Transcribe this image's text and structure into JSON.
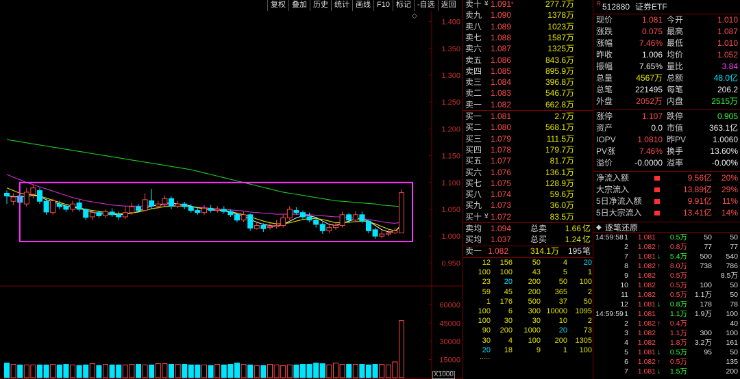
{
  "toolbar": [
    "复权",
    "叠加",
    "历史",
    "统计",
    "画线",
    "F10",
    "标记",
    "-自选",
    "返回"
  ],
  "chart_data": {
    "type": "candlestick",
    "price_ticks": [
      "1.400",
      "1.350",
      "1.300",
      "1.250",
      "1.200",
      "1.150",
      "1.100",
      "1.050",
      "1.000",
      "0.950"
    ],
    "price_range": [
      0.925,
      1.425
    ],
    "volume_ticks": [
      "60000",
      "45000",
      "30000",
      "15000"
    ],
    "volume_range": [
      0,
      70000
    ],
    "volume_unit": "X1000",
    "candles": [
      [
        1.08,
        1.075,
        1.085,
        1.06
      ],
      [
        1.065,
        1.073,
        1.08,
        1.058
      ],
      [
        1.075,
        1.063,
        1.082,
        1.058
      ],
      [
        1.06,
        1.082,
        1.09,
        1.055
      ],
      [
        1.078,
        1.09,
        1.096,
        1.07
      ],
      [
        1.085,
        1.065,
        1.09,
        1.06
      ],
      [
        1.065,
        1.045,
        1.07,
        1.04
      ],
      [
        1.044,
        1.066,
        1.07,
        1.04
      ],
      [
        1.06,
        1.055,
        1.066,
        1.05
      ],
      [
        1.056,
        1.05,
        1.06,
        1.045
      ],
      [
        1.05,
        1.06,
        1.066,
        1.045
      ],
      [
        1.062,
        1.05,
        1.068,
        1.046
      ],
      [
        1.05,
        1.035,
        1.052,
        1.03
      ],
      [
        1.036,
        1.044,
        1.048,
        1.03
      ],
      [
        1.044,
        1.038,
        1.048,
        1.034
      ],
      [
        1.038,
        1.046,
        1.05,
        1.034
      ],
      [
        1.045,
        1.04,
        1.052,
        1.036
      ],
      [
        1.04,
        1.036,
        1.046,
        1.03
      ],
      [
        1.036,
        1.044,
        1.056,
        1.032
      ],
      [
        1.044,
        1.055,
        1.062,
        1.04
      ],
      [
        1.055,
        1.048,
        1.06,
        1.044
      ],
      [
        1.048,
        1.068,
        1.08,
        1.046
      ],
      [
        1.066,
        1.056,
        1.088,
        1.05
      ],
      [
        1.056,
        1.06,
        1.066,
        1.05
      ],
      [
        1.06,
        1.07,
        1.076,
        1.056
      ],
      [
        1.07,
        1.056,
        1.074,
        1.05
      ],
      [
        1.056,
        1.06,
        1.066,
        1.052
      ],
      [
        1.06,
        1.055,
        1.064,
        1.05
      ],
      [
        1.055,
        1.048,
        1.06,
        1.044
      ],
      [
        1.048,
        1.044,
        1.054,
        1.04
      ],
      [
        1.044,
        1.052,
        1.058,
        1.04
      ],
      [
        1.052,
        1.048,
        1.058,
        1.044
      ],
      [
        1.048,
        1.05,
        1.056,
        1.044
      ],
      [
        1.05,
        1.046,
        1.056,
        1.042
      ],
      [
        1.046,
        1.04,
        1.05,
        1.036
      ],
      [
        1.04,
        1.03,
        1.044,
        1.026
      ],
      [
        1.03,
        1.04,
        1.046,
        1.026
      ],
      [
        1.04,
        1.015,
        1.042,
        1.01
      ],
      [
        1.014,
        1.02,
        1.026,
        1.012
      ],
      [
        1.02,
        1.014,
        1.024,
        1.008
      ],
      [
        1.016,
        1.018,
        1.024,
        1.012
      ],
      [
        1.018,
        1.02,
        1.03,
        1.014
      ],
      [
        1.02,
        1.034,
        1.04,
        1.016
      ],
      [
        1.034,
        1.05,
        1.056,
        1.03
      ],
      [
        1.048,
        1.044,
        1.054,
        1.04
      ],
      [
        1.044,
        1.036,
        1.048,
        1.03
      ],
      [
        1.036,
        1.03,
        1.044,
        1.026
      ],
      [
        1.03,
        1.022,
        1.036,
        1.016
      ],
      [
        1.022,
        1.01,
        1.026,
        1.004
      ],
      [
        1.01,
        1.016,
        1.024,
        1.006
      ],
      [
        1.016,
        1.02,
        1.026,
        1.012
      ],
      [
        1.02,
        1.04,
        1.046,
        1.016
      ],
      [
        1.04,
        1.03,
        1.044,
        1.024
      ],
      [
        1.03,
        1.04,
        1.046,
        1.026
      ],
      [
        1.04,
        1.028,
        1.046,
        1.024
      ],
      [
        1.028,
        1.01,
        1.03,
        1.005
      ],
      [
        1.012,
        1.0,
        1.016,
        0.995
      ],
      [
        1.0,
        1.004,
        1.01,
        0.996
      ],
      [
        1.004,
        1.006,
        1.014,
        1.0
      ],
      [
        1.006,
        1.01,
        1.016,
        1.004
      ],
      [
        1.006,
        1.081,
        1.087,
        1.006
      ]
    ],
    "volumes": [
      12000,
      11000,
      10500,
      10500,
      10500,
      10500,
      10500,
      11000,
      10500,
      11000,
      10500,
      10000,
      10500,
      11500,
      10000,
      11000,
      10500,
      10500,
      10500,
      11000,
      11000,
      10500,
      10500,
      11500,
      11500,
      11000,
      11000,
      11000,
      10500,
      10500,
      10500,
      10000,
      11000,
      10500,
      11000,
      12000,
      11000,
      10500,
      10000,
      10000,
      11000,
      10500,
      10000,
      10500,
      10500,
      11000,
      11000,
      12000,
      11500,
      10500,
      12000,
      11000,
      11000,
      11000,
      11000,
      10500,
      11000,
      11000,
      10500,
      13000,
      47000
    ],
    "ma_green": [
      1.18,
      1.178,
      1.176,
      1.174,
      1.172,
      1.17,
      1.168,
      1.166,
      1.164,
      1.162,
      1.16,
      1.158,
      1.156,
      1.154,
      1.152,
      1.15,
      1.148,
      1.146,
      1.144,
      1.142,
      1.14,
      1.138,
      1.136,
      1.134,
      1.132,
      1.13,
      1.128,
      1.126,
      1.124,
      1.121,
      1.118,
      1.115,
      1.112,
      1.109,
      1.106,
      1.103,
      1.1,
      1.097,
      1.094,
      1.091,
      1.088,
      1.085,
      1.082,
      1.08,
      1.078,
      1.076,
      1.074,
      1.072,
      1.07,
      1.068,
      1.066,
      1.065,
      1.064,
      1.063,
      1.062,
      1.061,
      1.06,
      1.058,
      1.057,
      1.056,
      1.055
    ],
    "ma_magenta": [
      1.115,
      1.11,
      1.105,
      1.1,
      1.096,
      1.092,
      1.088,
      1.084,
      1.08,
      1.076,
      1.072,
      1.069,
      1.066,
      1.064,
      1.062,
      1.06,
      1.058,
      1.057,
      1.056,
      1.056,
      1.056,
      1.056,
      1.057,
      1.058,
      1.058,
      1.058,
      1.057,
      1.056,
      1.055,
      1.054,
      1.053,
      1.052,
      1.051,
      1.05,
      1.049,
      1.048,
      1.047,
      1.045,
      1.044,
      1.043,
      1.042,
      1.041,
      1.041,
      1.041,
      1.041,
      1.041,
      1.04,
      1.039,
      1.038,
      1.037,
      1.036,
      1.036,
      1.035,
      1.034,
      1.033,
      1.031,
      1.029,
      1.027,
      1.025,
      1.024,
      1.026
    ],
    "ma_white": [
      1.075,
      1.074,
      1.073,
      1.074,
      1.076,
      1.074,
      1.068,
      1.064,
      1.06,
      1.056,
      1.054,
      1.052,
      1.048,
      1.045,
      1.042,
      1.041,
      1.041,
      1.04,
      1.041,
      1.043,
      1.046,
      1.052,
      1.056,
      1.058,
      1.061,
      1.062,
      1.06,
      1.059,
      1.056,
      1.053,
      1.051,
      1.049,
      1.048,
      1.047,
      1.045,
      1.041,
      1.038,
      1.031,
      1.026,
      1.022,
      1.02,
      1.018,
      1.022,
      1.028,
      1.034,
      1.038,
      1.038,
      1.035,
      1.028,
      1.022,
      1.02,
      1.024,
      1.028,
      1.032,
      1.032,
      1.028,
      1.02,
      1.012,
      1.008,
      1.008,
      1.022
    ],
    "ma_yellow": [
      1.09,
      1.085,
      1.08,
      1.078,
      1.077,
      1.075,
      1.071,
      1.067,
      1.063,
      1.059,
      1.056,
      1.053,
      1.05,
      1.048,
      1.046,
      1.044,
      1.043,
      1.042,
      1.042,
      1.043,
      1.045,
      1.048,
      1.051,
      1.053,
      1.055,
      1.056,
      1.056,
      1.056,
      1.055,
      1.053,
      1.051,
      1.05,
      1.049,
      1.048,
      1.046,
      1.043,
      1.04,
      1.036,
      1.032,
      1.028,
      1.025,
      1.023,
      1.023,
      1.025,
      1.028,
      1.031,
      1.033,
      1.033,
      1.031,
      1.028,
      1.025,
      1.025,
      1.026,
      1.027,
      1.028,
      1.027,
      1.023,
      1.018,
      1.013,
      1.01,
      1.018
    ],
    "highlight_box": {
      "from_index": 3,
      "to_index": 60,
      "price_top": 1.1,
      "price_bottom": 0.99
    }
  },
  "sell_orders": [
    {
      "label": "卖十",
      "price": "1.091",
      "vol": "277.7",
      "unit": "万",
      "mark": "¥",
      "mark2": "*"
    },
    {
      "label": "卖九",
      "price": "1.090",
      "vol": "1378",
      "unit": "万"
    },
    {
      "label": "卖八",
      "price": "1.089",
      "vol": "1023",
      "unit": "万"
    },
    {
      "label": "卖七",
      "price": "1.088",
      "vol": "1587",
      "unit": "万"
    },
    {
      "label": "卖六",
      "price": "1.087",
      "vol": "1325",
      "unit": "万"
    },
    {
      "label": "卖五",
      "price": "1.086",
      "vol": "843.6",
      "unit": "万"
    },
    {
      "label": "卖四",
      "price": "1.085",
      "vol": "895.9",
      "unit": "万"
    },
    {
      "label": "卖三",
      "price": "1.084",
      "vol": "396.8",
      "unit": "万"
    },
    {
      "label": "卖二",
      "price": "1.083",
      "vol": "546.7",
      "unit": "万"
    },
    {
      "label": "卖一",
      "price": "1.082",
      "vol": "662.8",
      "unit": "万"
    }
  ],
  "buy_orders": [
    {
      "label": "买一",
      "price": "1.081",
      "vol": "2.7",
      "unit": "万"
    },
    {
      "label": "买二",
      "price": "1.080",
      "vol": "568.1",
      "unit": "万"
    },
    {
      "label": "买三",
      "price": "1.079",
      "vol": "111.5",
      "unit": "万"
    },
    {
      "label": "买四",
      "price": "1.078",
      "vol": "179.7",
      "unit": "万"
    },
    {
      "label": "买五",
      "price": "1.077",
      "vol": "81.7",
      "unit": "万"
    },
    {
      "label": "买六",
      "price": "1.076",
      "vol": "136.1",
      "unit": "万"
    },
    {
      "label": "买七",
      "price": "1.075",
      "vol": "128.9",
      "unit": "万"
    },
    {
      "label": "买八",
      "price": "1.074",
      "vol": "59.6",
      "unit": "万"
    },
    {
      "label": "买九",
      "price": "1.073",
      "vol": "36.0",
      "unit": "万"
    },
    {
      "label": "买十",
      "price": "1.072",
      "vol": "83.5",
      "unit": "万",
      "mark": "¥"
    }
  ],
  "avg": {
    "sell_avg_label": "卖均",
    "sell_avg": "1.094",
    "sell_total_label": "总卖",
    "sell_total": "1.66",
    "sell_total_unit": "亿",
    "buy_avg_label": "买均",
    "buy_avg": "1.037",
    "buy_total_label": "总买",
    "buy_total": "1.24",
    "buy_total_unit": "亿"
  },
  "queue": {
    "label": "卖一",
    "price": "1.082",
    "vol": "314.1",
    "unit": "万",
    "count": "195",
    "count_unit": "笔",
    "rows": [
      [
        "12",
        "156",
        "50",
        "4",
        "20"
      ],
      [
        "100",
        "100",
        "43",
        "5",
        "1"
      ],
      [
        "23",
        "20",
        "200",
        "50",
        "100"
      ],
      [
        "59",
        "45",
        "200",
        "365",
        "2"
      ],
      [
        "1",
        "176",
        "500",
        "37",
        "50"
      ],
      [
        "100",
        "6",
        "300",
        "10000",
        "1095"
      ],
      [
        "100",
        "30",
        "30",
        "10",
        "2"
      ],
      [
        "90",
        "200",
        "1000",
        "20",
        "73"
      ],
      [
        "30",
        "4",
        "100",
        "200",
        "1305"
      ],
      [
        "20",
        "18",
        "9",
        "1",
        "100"
      ]
    ],
    "more": "....."
  },
  "stock": {
    "code": "512880",
    "name": "证券ETF",
    "prefix": "R"
  },
  "quote_rows": [
    {
      "l1": "现价",
      "v1": "1.081",
      "c1": "red",
      "l2": "今开",
      "v2": "1.010",
      "c2": "red"
    },
    {
      "l1": "涨跌",
      "v1": "0.075",
      "c1": "red",
      "l2": "最高",
      "v2": "1.087",
      "c2": "red"
    },
    {
      "l1": "涨幅",
      "v1": "7.46%",
      "c1": "red",
      "l2": "最低",
      "v2": "1.010",
      "c2": "red"
    },
    {
      "l1": "昨收",
      "v1": "1.006",
      "c1": "white",
      "l2": "均价",
      "v2": "1.052",
      "c2": "red"
    },
    {
      "l1": "振幅",
      "v1": "7.65%",
      "c1": "white",
      "l2": "量比",
      "v2": "3.84",
      "c2": "magenta"
    },
    {
      "l1": "总量",
      "v1": "4567万",
      "c1": "yellow",
      "l2": "总额",
      "v2": "48.0亿",
      "c2": "cyan"
    },
    {
      "l1": "总笔",
      "v1": "221495",
      "c1": "white",
      "l2": "每笔",
      "v2": "206.2",
      "c2": "white"
    },
    {
      "l1": "外盘",
      "v1": "2052万",
      "c1": "red",
      "l2": "内盘",
      "v2": "2515万",
      "c2": "green"
    }
  ],
  "quote_rows2": [
    {
      "l1": "涨停",
      "v1": "1.107",
      "c1": "red",
      "l2": "跌停",
      "v2": "0.905",
      "c2": "green"
    },
    {
      "l1": "资产",
      "v1": "0.0",
      "c1": "white",
      "l2": "市值",
      "v2": "363.1亿",
      "c2": "white"
    },
    {
      "l1": "IOPV",
      "v1": "1.0810",
      "c1": "red",
      "l2": "昨PV",
      "v2": "1.0060",
      "c2": "white"
    },
    {
      "l1": "PV涨",
      "v1": "7.46%",
      "c1": "red",
      "l2": "换手",
      "v2": "13.60%",
      "c2": "white"
    },
    {
      "l1": "溢价",
      "v1": "-0.0000",
      "c1": "white",
      "l2": "溢率",
      "v2": "-0.00%",
      "c2": "white"
    }
  ],
  "flows": [
    {
      "label": "净流入额",
      "value": "9.56亿",
      "pct": "20%"
    },
    {
      "label": "大宗流入",
      "value": "13.89亿",
      "pct": "29%"
    },
    {
      "label": "5日净流入额",
      "value": "9.91亿",
      "pct": "11%"
    },
    {
      "label": "5日大宗流入",
      "value": "13.41亿",
      "pct": "14%"
    }
  ],
  "ticks_title": "逐笔还原",
  "ticks": [
    {
      "t": "14:59:58",
      "a": "1",
      "p": "1.081",
      "d": "",
      "v": "0.5万",
      "vc": "green",
      "x": "50",
      "y": "50",
      "xc": "white"
    },
    {
      "t": "",
      "a": "2",
      "p": "1.082",
      "d": "↑",
      "v": "0.8万",
      "vc": "red",
      "x": "77",
      "y": "77",
      "xc": "white"
    },
    {
      "t": "",
      "a": "7",
      "p": "1.081",
      "d": "↓",
      "v": "5.4万",
      "vc": "green",
      "x": "500",
      "y": "540",
      "xc": "white"
    },
    {
      "t": "",
      "a": "8",
      "p": "1.082",
      "d": "↑",
      "v": "8.0万",
      "vc": "red",
      "x": "738",
      "y": "786",
      "xc": "white"
    },
    {
      "t": "",
      "a": "9",
      "p": "1.082",
      "d": "",
      "v": "0.5万",
      "vc": "red",
      "x": "",
      "y": "8.5万",
      "xc": "white"
    },
    {
      "t": "",
      "a": "10",
      "p": "1.082",
      "d": "",
      "v": "0.5万",
      "vc": "red",
      "x": "100",
      "y": "50",
      "xc": "white"
    },
    {
      "t": "",
      "a": "11",
      "p": "1.082",
      "d": "",
      "v": "0.5万",
      "vc": "red",
      "x": "1.1万",
      "y": "50",
      "xc": "white"
    },
    {
      "t": "",
      "a": "12",
      "p": "1.081",
      "d": "↓",
      "v": "0.8万",
      "vc": "green",
      "x": "178",
      "y": "78",
      "xc": "white"
    },
    {
      "t": "14:59:59",
      "a": "1",
      "p": "1.081",
      "d": "",
      "v": "1.1万",
      "vc": "green",
      "x": "1.9万",
      "y": "100",
      "xc": "white"
    },
    {
      "t": "",
      "a": "2",
      "p": "1.082",
      "d": "↑",
      "v": "0.4万",
      "vc": "red",
      "x": "",
      "y": "40",
      "xc": "white"
    },
    {
      "t": "",
      "a": "3",
      "p": "1.082",
      "d": "",
      "v": "1.1万",
      "vc": "red",
      "x": "300",
      "y": "100",
      "xc": "white"
    },
    {
      "t": "",
      "a": "4",
      "p": "1.082",
      "d": "",
      "v": "1.8万",
      "vc": "red",
      "x": "3.2万",
      "y": "161",
      "xc": "white"
    },
    {
      "t": "",
      "a": "5",
      "p": "1.081",
      "d": "↓",
      "v": "0.5万",
      "vc": "green",
      "x": "95",
      "y": "50",
      "xc": "white"
    },
    {
      "t": "",
      "a": "6",
      "p": "1.082",
      "d": "↑",
      "v": "0.5万",
      "vc": "red",
      "x": "",
      "y": "135",
      "xc": "white"
    },
    {
      "t": "",
      "a": "7",
      "p": "1.081",
      "d": "↓",
      "v": "1.5万",
      "vc": "green",
      "x": "",
      "y": "200",
      "xc": "white"
    }
  ],
  "colors": {
    "up": "#ff4d4d",
    "down": "#00e5ff",
    "grid": "#7a0000",
    "box": "#ff33ff"
  }
}
